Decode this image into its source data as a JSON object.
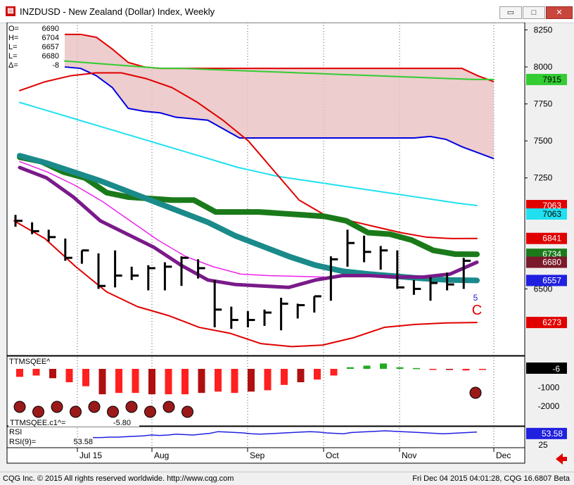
{
  "window": {
    "title": "INZDUSD - New Zealand (Dollar) Index, Weekly",
    "minimize": "▭",
    "maximize": "□",
    "close": "✕"
  },
  "ohlc": [
    {
      "label": "O=",
      "value": "6690"
    },
    {
      "label": "H=",
      "value": "6704"
    },
    {
      "label": "L=",
      "value": "6657"
    },
    {
      "label": "L=",
      "value": "6680"
    },
    {
      "label": "Δ=",
      "value": "-8"
    }
  ],
  "status": {
    "left": "CQG Inc. © 2015 All rights reserved worldwide. http://www.cqg.com",
    "right": "Fri Dec 04 2015 04:01:28, CQG 16.6807 Beta"
  },
  "colors": {
    "background": "#ffffff",
    "price_bars": "#000000",
    "cloud_red": "#e00000",
    "cloud_blue": "#0000e0",
    "green_line": "#33cc33",
    "cyan_line": "#20e0f0",
    "bollinger": "#e00000",
    "thick_green": "#1a7a1a",
    "teal": "#1a8a8a",
    "purple": "#7a1a8a",
    "magenta": "#ee22ee",
    "hist_red": "#ff2020",
    "hist_dark": "#b01010",
    "rsi": "#2020e0"
  },
  "chart_data": [
    {
      "type": "line",
      "name": "price",
      "y_ticks": [
        8250,
        8000,
        7750,
        7500,
        7250,
        6500
      ],
      "ylim": [
        6050,
        8300
      ],
      "x_labels": [
        "Jul 15",
        "Aug",
        "Sep",
        "Oct",
        "Nov",
        "Dec"
      ],
      "bars_close": [
        6960,
        6890,
        6850,
        6710,
        6760,
        6520,
        6590,
        6590,
        6640,
        6650,
        6710,
        6640,
        6360,
        6290,
        6290,
        6340,
        6400,
        6390,
        6450,
        6700,
        6810,
        6750,
        6760,
        6510,
        6500,
        6540,
        6530,
        6690
      ],
      "bars_high": [
        7000,
        6950,
        6900,
        6840,
        6760,
        6740,
        6760,
        6650,
        6660,
        6680,
        6720,
        6700,
        6560,
        6380,
        6350,
        6360,
        6440,
        6400,
        6450,
        6720,
        6900,
        6860,
        6790,
        6760,
        6560,
        6580,
        6610,
        6710
      ],
      "bars_low": [
        6920,
        6870,
        6820,
        6690,
        6670,
        6500,
        6510,
        6560,
        6490,
        6490,
        6520,
        6570,
        6240,
        6230,
        6240,
        6250,
        6220,
        6300,
        6340,
        6420,
        6650,
        6680,
        6630,
        6500,
        6460,
        6420,
        6490,
        6500
      ],
      "cloud_top": [
        8220,
        8220,
        8200,
        8120,
        8030,
        8000,
        7990,
        7990,
        7990,
        7990,
        7990,
        7990,
        7990,
        7990,
        7990,
        7990,
        7990,
        7990,
        7990,
        7990,
        7990,
        7990,
        7990,
        7990,
        7990,
        7990,
        7940,
        7900
      ],
      "cloud_bottom": [
        8000,
        7990,
        7940,
        7860,
        7720,
        7700,
        7690,
        7660,
        7650,
        7640,
        7580,
        7520,
        7520,
        7520,
        7520,
        7520,
        7520,
        7520,
        7520,
        7520,
        7520,
        7520,
        7520,
        7530,
        7510,
        7460,
        7420,
        7380
      ],
      "green_line": [
        8040,
        8030,
        8020,
        8010,
        8000,
        7990,
        7990,
        7985,
        7980,
        7975,
        7970,
        7965,
        7960,
        7955,
        7950,
        7945,
        7940,
        7935,
        7930,
        7925,
        7920,
        7915,
        7915
      ],
      "cyan_line": [
        7760,
        7720,
        7680,
        7640,
        7600,
        7560,
        7520,
        7480,
        7440,
        7400,
        7360,
        7320,
        7290,
        7260,
        7240,
        7220,
        7200,
        7180,
        7160,
        7140,
        7120,
        7100,
        7080,
        7063
      ],
      "bb_upper": [
        7840,
        7900,
        7940,
        7960,
        7960,
        7920,
        7860,
        7760,
        7640,
        7500,
        7300,
        7100,
        7000,
        6960,
        6920,
        6880,
        6850,
        6840,
        6841
      ],
      "bb_lower": [
        6960,
        6840,
        6650,
        6480,
        6380,
        6320,
        6240,
        6200,
        6130,
        6110,
        6120,
        6170,
        6240,
        6260,
        6270,
        6273
      ],
      "thick_green": [
        7390,
        7360,
        7290,
        7250,
        7150,
        7120,
        7110,
        7100,
        7100,
        7020,
        7020,
        7020,
        7010,
        7000,
        6990,
        6960,
        6880,
        6870,
        6830,
        6760,
        6735,
        6734
      ],
      "teal": [
        7400,
        7350,
        7290,
        7230,
        7160,
        7090,
        7020,
        6950,
        6860,
        6790,
        6720,
        6660,
        6620,
        6600,
        6585,
        6570,
        6560,
        6557
      ],
      "purple": [
        7320,
        7250,
        7120,
        6960,
        6870,
        6780,
        6660,
        6560,
        6530,
        6520,
        6510,
        6560,
        6590,
        6590,
        6580,
        6580,
        6600,
        6680
      ],
      "magenta": [
        7360,
        7290,
        7200,
        7090,
        6960,
        6830,
        6720,
        6650,
        6600,
        6590,
        6585,
        6580
      ],
      "labels_right": [
        {
          "value": "7915",
          "color": "#33cc33",
          "text_color": "#000000"
        },
        {
          "value": "7063",
          "color": "#e00000",
          "text_color": "#ffffff"
        },
        {
          "value": "7063",
          "color": "#20e0f0",
          "text_color": "#000000"
        },
        {
          "value": "6841",
          "color": "#e00000",
          "text_color": "#ffffff"
        },
        {
          "value": "6734",
          "color": "#1a7a1a",
          "text_color": "#ffffff"
        },
        {
          "value": "6680",
          "color": "#7a1a2a",
          "text_color": "#ffffff"
        },
        {
          "value": "6557",
          "color": "#2020e0",
          "text_color": "#ffffff"
        },
        {
          "value": "6273",
          "color": "#e00000",
          "text_color": "#ffffff"
        }
      ],
      "annotation_count": "5",
      "annotation_letter": "C"
    },
    {
      "type": "bar",
      "name": "TTMSQEE^",
      "title": "TTMSQEE^",
      "y_ticks": [
        -1000,
        -2000
      ],
      "current_value": "-6",
      "values": [
        -300,
        -250,
        -350,
        -500,
        -650,
        -950,
        -900,
        -900,
        -950,
        -950,
        -950,
        -900,
        -850,
        -900,
        -850,
        -800,
        -600,
        -500,
        -400,
        -250,
        60,
        120,
        200,
        60,
        30,
        -30,
        -40,
        -60,
        -40
      ],
      "dots_at": [
        0,
        1,
        2,
        3,
        4,
        5,
        6,
        7,
        8,
        9,
        26
      ],
      "subtitle": "TTMSQEE.c1^=",
      "subtitle_value": "-5.80"
    },
    {
      "type": "line",
      "name": "RSI",
      "title": "RSI",
      "sub_label": "RSI(9)=",
      "sub_value": "53.58",
      "current_value": "53.58",
      "y_ticks": [
        25
      ],
      "values": [
        44,
        44,
        45,
        45,
        46,
        47,
        48,
        50,
        49,
        50,
        52,
        51,
        50,
        52,
        54,
        58,
        57,
        56,
        55,
        53,
        52,
        53,
        54,
        55,
        56,
        57,
        58,
        57,
        55,
        54,
        53,
        56,
        57,
        58,
        59,
        60,
        59,
        58,
        57,
        56,
        55,
        54,
        53,
        54,
        55,
        56,
        57
      ]
    }
  ]
}
